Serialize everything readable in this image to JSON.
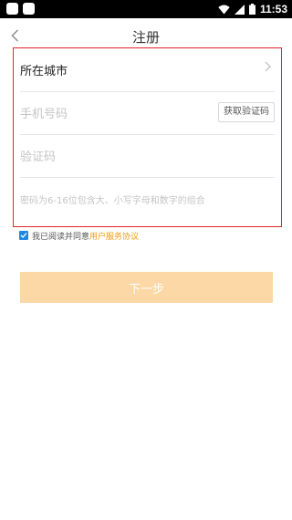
{
  "status_bar": {
    "time": "11:53",
    "icons": [
      "app-square-icon",
      "app-square-icon",
      "wifi-icon",
      "signal-icon",
      "battery-icon"
    ]
  },
  "header": {
    "title": "注册",
    "back_icon": "chevron-left-icon"
  },
  "form": {
    "city": {
      "label": "所在城市",
      "icon": "chevron-right-icon"
    },
    "phone": {
      "placeholder": "手机号码",
      "get_code_label": "获取验证码"
    },
    "code": {
      "placeholder": "验证码"
    },
    "password": {
      "placeholder": "密码为6-16位包含大、小写字母和数字的组合"
    }
  },
  "agreement": {
    "checked": true,
    "text": "我已阅读并同意",
    "link_text": "用户服务协议"
  },
  "next_button": {
    "label": "下一步"
  },
  "colors": {
    "accent": "#f39c12",
    "button_bg": "#fbd8a5",
    "highlight_border": "#e3242b",
    "checkbox": "#1e88e5"
  }
}
